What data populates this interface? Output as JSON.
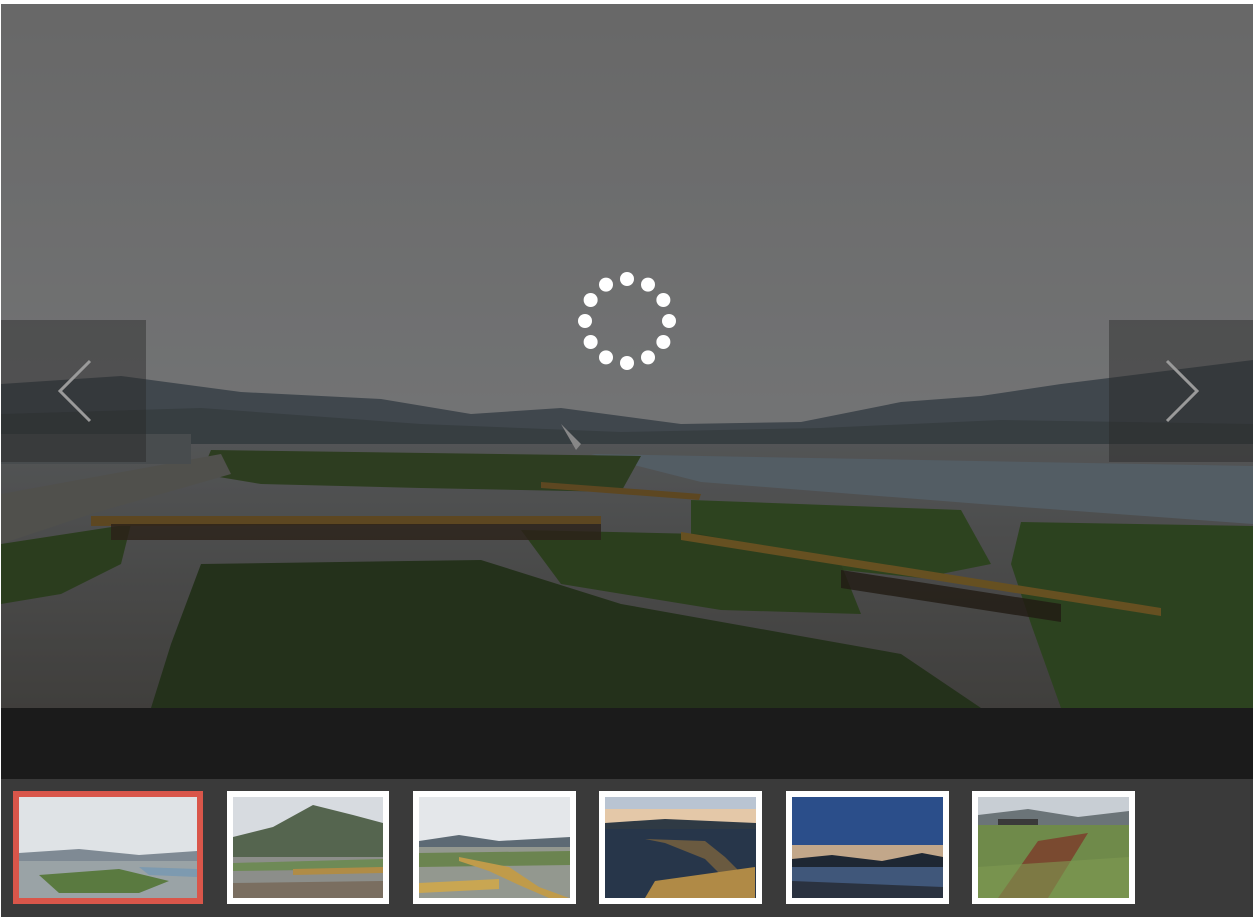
{
  "gallery": {
    "main_photo": "wetland-boardwalk-photo",
    "loading": true,
    "prev_icon": "chevron-left-icon",
    "next_icon": "chevron-right-icon",
    "spinner_icon": "loading-spinner-icon",
    "caption": "",
    "active_thumbnail": 1,
    "thumbnail_count": 6
  },
  "colors": {
    "active_thumb_border": "#d9564a",
    "caption_bar": "#1b1b1b",
    "thumb_strip": "#3a3a3a"
  }
}
